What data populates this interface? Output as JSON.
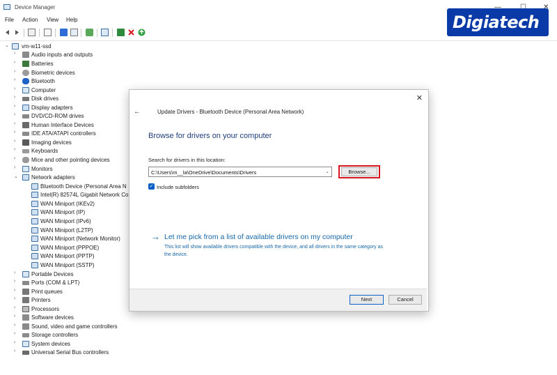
{
  "window": {
    "title": "Device Manager",
    "controls": [
      "—",
      "☐",
      "✕"
    ]
  },
  "menu": [
    "File",
    "Action",
    "View",
    "Help"
  ],
  "toolbar_icons": [
    "back-icon",
    "forward-icon",
    "properties-icon",
    "show-hidden-icon",
    "help-icon",
    "view-icon",
    "update-driver-icon",
    "scan-hardware-icon",
    "enable-device-icon",
    "uninstall-icon",
    "install-legacy-icon"
  ],
  "tree": {
    "root": "vm-w11-ssd",
    "categories": [
      "Audio inputs and outputs",
      "Batteries",
      "Biometric devices",
      "Bluetooth",
      "Computer",
      "Disk drives",
      "Display adapters",
      "DVD/CD-ROM drives",
      "Human Interface Devices",
      "IDE ATA/ATAPI controllers",
      "Imaging devices",
      "Keyboards",
      "Mice and other pointing devices",
      "Monitors",
      "Network adapters"
    ],
    "network_children": [
      "Bluetooth Device (Personal Area N",
      "Intel(R) 82574L Gigabit Network Co",
      "WAN Miniport (IKEv2)",
      "WAN Miniport (IP)",
      "WAN Miniport (IPv6)",
      "WAN Miniport (L2TP)",
      "WAN Miniport (Network Monitor)",
      "WAN Miniport (PPPOE)",
      "WAN Miniport (PPTP)",
      "WAN Miniport (SSTP)"
    ],
    "categories_after": [
      "Portable Devices",
      "Ports (COM & LPT)",
      "Print queues",
      "Printers",
      "Processors",
      "Software devices",
      "Sound, video and game controllers",
      "Storage controllers",
      "System devices",
      "Universal Serial Bus controllers"
    ]
  },
  "brand": {
    "text": "Digiatech"
  },
  "dialog": {
    "title": "Update Drivers - Bluetooth Device (Personal Area Network)",
    "heading": "Browse for drivers on your computer",
    "search_label": "Search for drivers in this location:",
    "path_value": "C:\\Users\\m__la\\OneDrive\\Documents\\Drivers",
    "browse_label": "Browse...",
    "include_subfolders": "Include subfolders",
    "pick_link": "Let me pick from a list of available drivers on my computer",
    "pick_desc": "This list will show available drivers compatible with the device, and all drivers in the same category as the device.",
    "next_label": "Next",
    "cancel_label": "Cancel"
  },
  "colors": {
    "link": "#1667a8",
    "heading": "#1f3f7a",
    "highlight": "#d8141c",
    "brand_bg": "#0a3aa8"
  }
}
